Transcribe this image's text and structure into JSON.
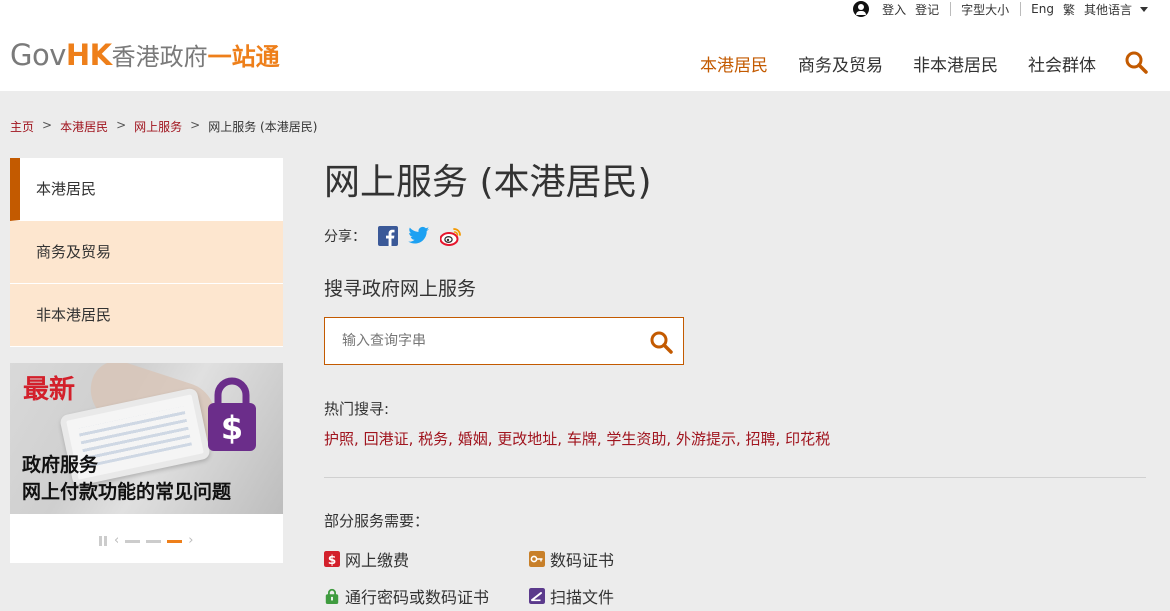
{
  "topbar": {
    "login": "登入",
    "register": "登记",
    "font_size": "字型大小",
    "lang_en": "Eng",
    "lang_tc": "繁",
    "other_lang": "其他语言"
  },
  "logo": {
    "gov": "Gov",
    "hk": "HK",
    "cn": "香港政府",
    "cn2": "一站通"
  },
  "nav": {
    "items": [
      {
        "label": "本港居民",
        "active": true
      },
      {
        "label": "商务及贸易"
      },
      {
        "label": "非本港居民"
      },
      {
        "label": "社会群体"
      }
    ]
  },
  "breadcrumb": {
    "items": [
      "主页",
      "本港居民",
      "网上服务"
    ],
    "current": "网上服务 (本港居民)"
  },
  "sidebar": {
    "items": [
      {
        "label": "本港居民",
        "active": true
      },
      {
        "label": "商务及贸易"
      },
      {
        "label": "非本港居民"
      }
    ]
  },
  "banner": {
    "badge": "最新",
    "line1": "政府服务",
    "line2": "网上付款功能的常见问题",
    "lock_symbol": "$"
  },
  "page": {
    "title": "网上服务 (本港居民)",
    "share_label": "分享："
  },
  "search": {
    "heading": "搜寻政府网上服务",
    "placeholder": "输入查询字串"
  },
  "hot": {
    "label": "热门搜寻:",
    "items": [
      "护照",
      "回港证",
      "税务",
      "婚姻",
      "更改地址",
      "车牌",
      "学生资助",
      "外游提示",
      "招聘",
      "印花税"
    ]
  },
  "requirements": {
    "label": "部分服务需要：",
    "items": [
      {
        "label": "网上缴费",
        "icon": "payment-icon"
      },
      {
        "label": "数码证书",
        "icon": "key-icon"
      },
      {
        "label": "通行密码或数码证书",
        "icon": "lock-icon"
      },
      {
        "label": "扫描文件",
        "icon": "scan-icon"
      }
    ]
  },
  "colors": {
    "brand_orange": "#ee7f1a",
    "accent": "#c35a00",
    "link_red": "#a0141e",
    "sidebar_bg": "#fde6cf"
  }
}
